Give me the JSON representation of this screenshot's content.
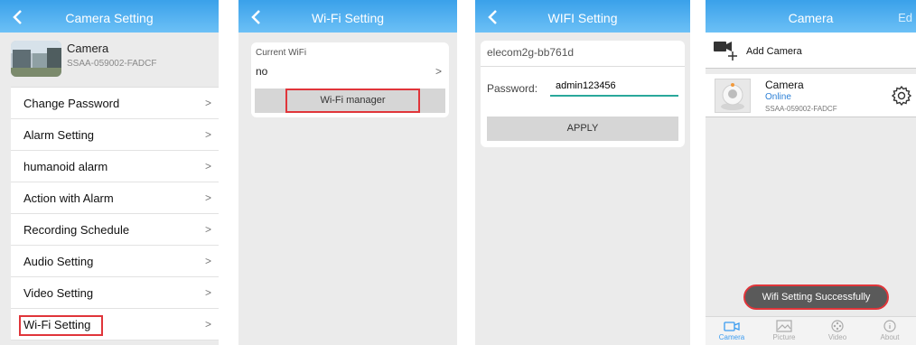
{
  "panel1": {
    "header_title": "Camera Setting",
    "camera_name": "Camera",
    "camera_id": "SSAA-059002-FADCF",
    "menu": [
      {
        "label": "Change Password"
      },
      {
        "label": "Alarm Setting"
      },
      {
        "label": "humanoid alarm"
      },
      {
        "label": "Action with Alarm"
      },
      {
        "label": "Recording Schedule"
      },
      {
        "label": "Audio Setting"
      },
      {
        "label": "Video Setting"
      },
      {
        "label": "Wi-Fi Setting",
        "highlighted": true
      }
    ],
    "chevron": ">"
  },
  "panel2": {
    "header_title": "Wi-Fi Setting",
    "current_wifi_label": "Current WiFi",
    "current_wifi_value": "no",
    "chevron": ">",
    "wifi_manager_label": "Wi-Fi manager"
  },
  "panel3": {
    "header_title": "WIFI Setting",
    "ssid": "elecom2g-bb761d",
    "password_label": "Password:",
    "password_value": "admin123456",
    "apply_label": "APPLY"
  },
  "panel4": {
    "header_title": "Camera",
    "header_right": "Ed",
    "add_camera_label": "Add Camera",
    "camera_name": "Camera",
    "camera_status": "Online",
    "camera_id": "SSAA-059002-FADCF",
    "toast": "Wifi Setting Successfully",
    "tabs": [
      {
        "label": "Camera",
        "icon": "camera-tab-icon",
        "active": true
      },
      {
        "label": "Picture",
        "icon": "picture-tab-icon",
        "active": false
      },
      {
        "label": "Video",
        "icon": "video-tab-icon",
        "active": false
      },
      {
        "label": "About",
        "icon": "info-tab-icon",
        "active": false
      }
    ]
  },
  "colors": {
    "header_top": "#3aa1ea",
    "header_bottom": "#6cc0f6",
    "highlight_red": "#e0353a",
    "online_blue": "#2b7fd6",
    "input_underline": "#2aa89b"
  }
}
